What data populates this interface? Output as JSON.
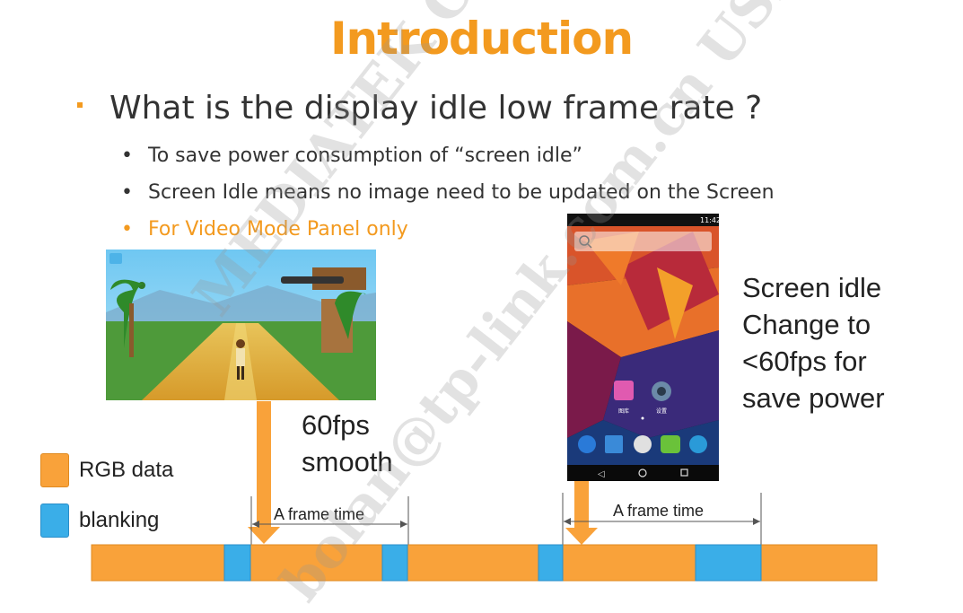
{
  "title": "Introduction",
  "main_bullet": "What is the display idle low frame rate ?",
  "sub_bullets": [
    "To save power consumption of “screen idle”",
    "Screen Idle means no image need to be updated on the Screen",
    "For Video Mode Panel only"
  ],
  "left_label": [
    "60fps",
    "smooth"
  ],
  "right_label": [
    "Screen idle",
    "Change to",
    "<60fps for",
    "save power"
  ],
  "legend": {
    "rgb": "RGB data",
    "blank": "blanking"
  },
  "frame_time_label": "A frame time",
  "phone": {
    "time": "11:42",
    "app1": "图库",
    "app2": "设置"
  },
  "watermark": {
    "line1": "MEDIATEK CONFIDENTIAL",
    "line2": "bolan@tp-link.com.cn USE"
  },
  "colors": {
    "accent": "#f39a1f",
    "rgb_data": "#f9a23a",
    "blanking": "#3aaee8"
  }
}
